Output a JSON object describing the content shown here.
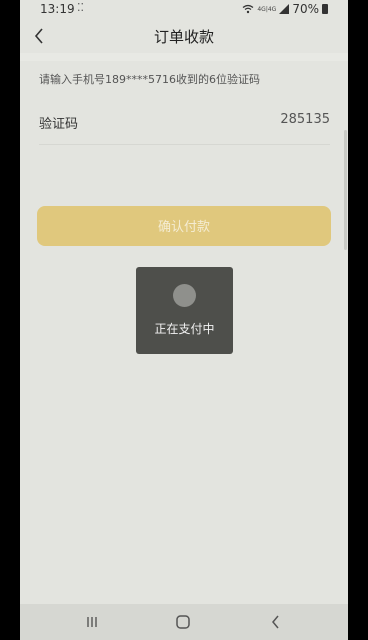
{
  "status_bar": {
    "time": "13:19",
    "dots": "⁚⁚",
    "network": "4G|4G",
    "battery": "70%"
  },
  "header": {
    "title": "订单收款"
  },
  "hint": "请输入手机号189****5716收到的6位验证码",
  "code_field": {
    "label": "验证码",
    "value": "285135"
  },
  "confirm_button": {
    "label": "确认付款"
  },
  "toast": {
    "text": "正在支付中"
  },
  "colors": {
    "accent": "#e0c87d",
    "background": "#e3e4df",
    "toast": "#4e4f4b"
  },
  "icons": {
    "back": "chevron-left-icon",
    "wifi": "wifi-icon",
    "signal": "signal-icon",
    "battery": "battery-icon"
  }
}
